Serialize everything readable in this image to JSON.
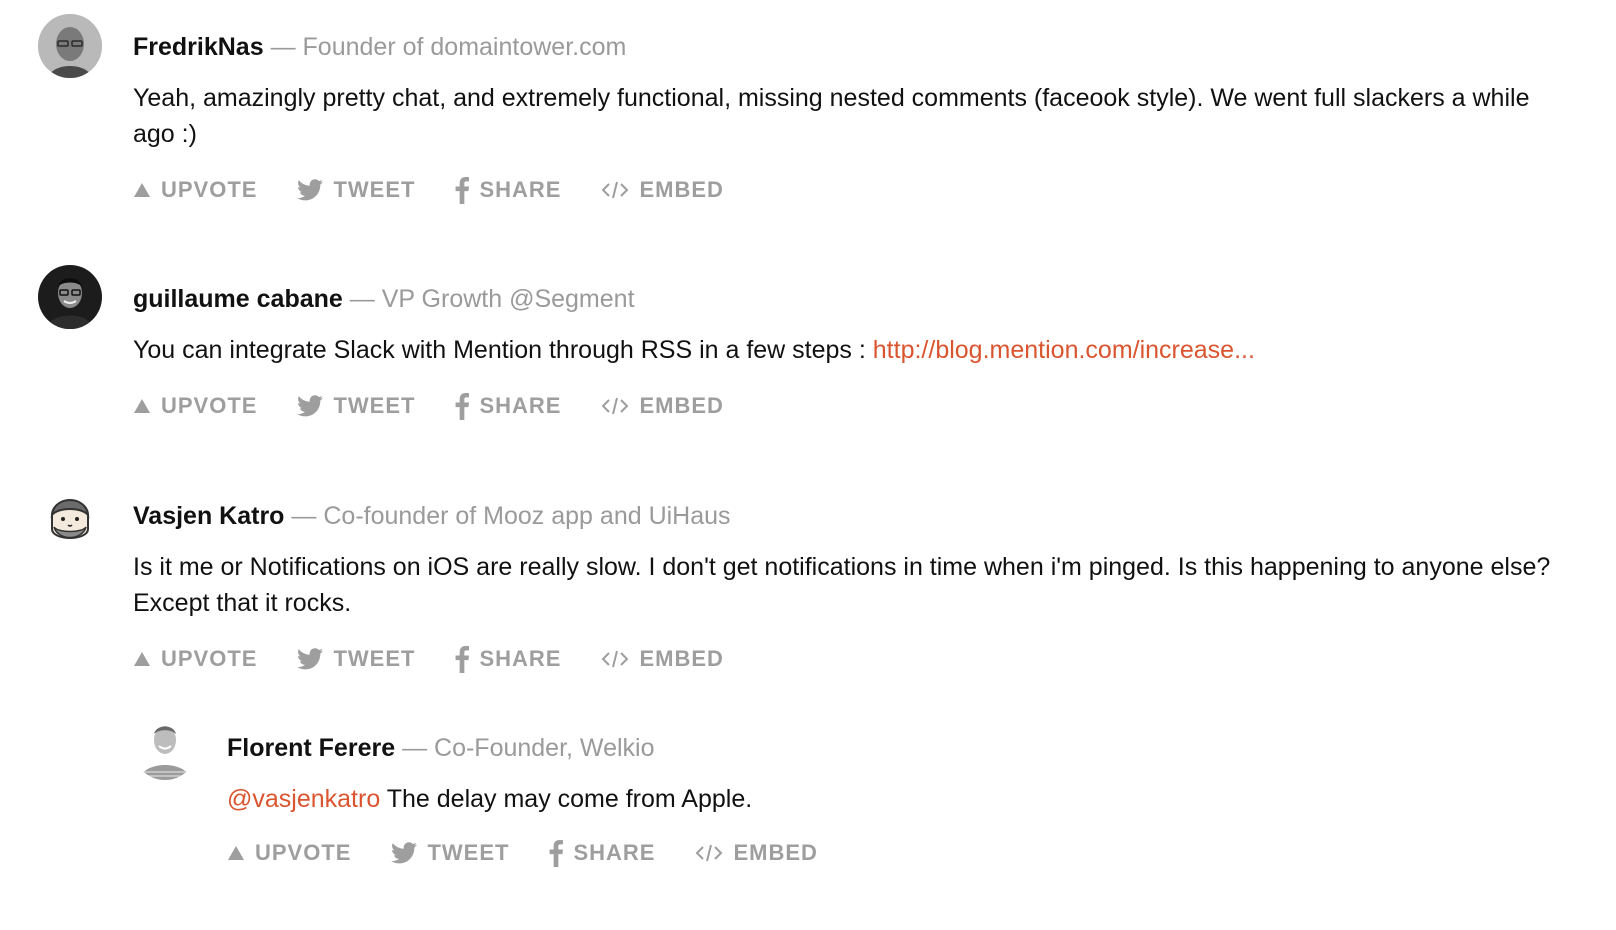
{
  "comments": [
    {
      "author": "FredrikNas",
      "separator": "—",
      "headline": "Founder of domaintower.com",
      "text": "Yeah, amazingly pretty chat, and extremely functional, missing nested comments (faceook style). We went full slackers a while ago :)",
      "actions": {
        "upvote": "UPVOTE",
        "tweet": "TWEET",
        "share": "SHARE",
        "embed": "EMBED"
      }
    },
    {
      "author": "guillaume cabane",
      "separator": "—",
      "headline": "VP Growth @Segment",
      "text": "You can integrate Slack with Mention through RSS in a few steps :",
      "link": "http://blog.mention.com/increase...",
      "actions": {
        "upvote": "UPVOTE",
        "tweet": "TWEET",
        "share": "SHARE",
        "embed": "EMBED"
      }
    },
    {
      "author": "Vasjen Katro",
      "separator": "—",
      "headline": "Co-founder of Mooz app and UiHaus",
      "text": "Is it me or Notifications on iOS are really slow. I don't get notifications in time when i'm pinged. Is this happening to anyone else? Except that it rocks.",
      "actions": {
        "upvote": "UPVOTE",
        "tweet": "TWEET",
        "share": "SHARE",
        "embed": "EMBED"
      }
    },
    {
      "author": "Florent Ferere",
      "separator": "—",
      "headline": "Co-Founder, Welkio",
      "mention": "@vasjenkatro",
      "text": "The delay may come from Apple.",
      "actions": {
        "upvote": "UPVOTE",
        "tweet": "TWEET",
        "share": "SHARE",
        "embed": "EMBED"
      }
    }
  ],
  "colors": {
    "link": "#da552f",
    "meta": "#9a9a9a",
    "action": "#9e9e9e",
    "text": "#111111"
  },
  "icons": {
    "upvote": "triangle-up-icon",
    "tweet": "twitter-bird-icon",
    "share": "facebook-f-icon",
    "embed": "code-brackets-icon"
  }
}
